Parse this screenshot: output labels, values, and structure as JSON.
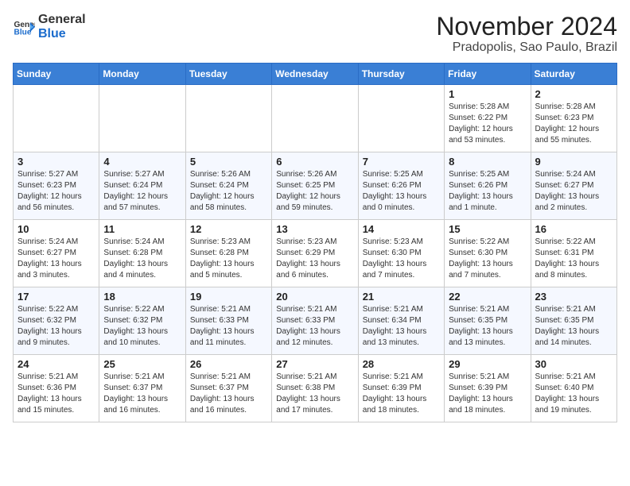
{
  "logo": {
    "general": "General",
    "blue": "Blue"
  },
  "title": "November 2024",
  "location": "Pradopolis, Sao Paulo, Brazil",
  "headers": [
    "Sunday",
    "Monday",
    "Tuesday",
    "Wednesday",
    "Thursday",
    "Friday",
    "Saturday"
  ],
  "weeks": [
    [
      {
        "day": "",
        "info": ""
      },
      {
        "day": "",
        "info": ""
      },
      {
        "day": "",
        "info": ""
      },
      {
        "day": "",
        "info": ""
      },
      {
        "day": "",
        "info": ""
      },
      {
        "day": "1",
        "info": "Sunrise: 5:28 AM\nSunset: 6:22 PM\nDaylight: 12 hours and 53 minutes."
      },
      {
        "day": "2",
        "info": "Sunrise: 5:28 AM\nSunset: 6:23 PM\nDaylight: 12 hours and 55 minutes."
      }
    ],
    [
      {
        "day": "3",
        "info": "Sunrise: 5:27 AM\nSunset: 6:23 PM\nDaylight: 12 hours and 56 minutes."
      },
      {
        "day": "4",
        "info": "Sunrise: 5:27 AM\nSunset: 6:24 PM\nDaylight: 12 hours and 57 minutes."
      },
      {
        "day": "5",
        "info": "Sunrise: 5:26 AM\nSunset: 6:24 PM\nDaylight: 12 hours and 58 minutes."
      },
      {
        "day": "6",
        "info": "Sunrise: 5:26 AM\nSunset: 6:25 PM\nDaylight: 12 hours and 59 minutes."
      },
      {
        "day": "7",
        "info": "Sunrise: 5:25 AM\nSunset: 6:26 PM\nDaylight: 13 hours and 0 minutes."
      },
      {
        "day": "8",
        "info": "Sunrise: 5:25 AM\nSunset: 6:26 PM\nDaylight: 13 hours and 1 minute."
      },
      {
        "day": "9",
        "info": "Sunrise: 5:24 AM\nSunset: 6:27 PM\nDaylight: 13 hours and 2 minutes."
      }
    ],
    [
      {
        "day": "10",
        "info": "Sunrise: 5:24 AM\nSunset: 6:27 PM\nDaylight: 13 hours and 3 minutes."
      },
      {
        "day": "11",
        "info": "Sunrise: 5:24 AM\nSunset: 6:28 PM\nDaylight: 13 hours and 4 minutes."
      },
      {
        "day": "12",
        "info": "Sunrise: 5:23 AM\nSunset: 6:28 PM\nDaylight: 13 hours and 5 minutes."
      },
      {
        "day": "13",
        "info": "Sunrise: 5:23 AM\nSunset: 6:29 PM\nDaylight: 13 hours and 6 minutes."
      },
      {
        "day": "14",
        "info": "Sunrise: 5:23 AM\nSunset: 6:30 PM\nDaylight: 13 hours and 7 minutes."
      },
      {
        "day": "15",
        "info": "Sunrise: 5:22 AM\nSunset: 6:30 PM\nDaylight: 13 hours and 7 minutes."
      },
      {
        "day": "16",
        "info": "Sunrise: 5:22 AM\nSunset: 6:31 PM\nDaylight: 13 hours and 8 minutes."
      }
    ],
    [
      {
        "day": "17",
        "info": "Sunrise: 5:22 AM\nSunset: 6:32 PM\nDaylight: 13 hours and 9 minutes."
      },
      {
        "day": "18",
        "info": "Sunrise: 5:22 AM\nSunset: 6:32 PM\nDaylight: 13 hours and 10 minutes."
      },
      {
        "day": "19",
        "info": "Sunrise: 5:21 AM\nSunset: 6:33 PM\nDaylight: 13 hours and 11 minutes."
      },
      {
        "day": "20",
        "info": "Sunrise: 5:21 AM\nSunset: 6:33 PM\nDaylight: 13 hours and 12 minutes."
      },
      {
        "day": "21",
        "info": "Sunrise: 5:21 AM\nSunset: 6:34 PM\nDaylight: 13 hours and 13 minutes."
      },
      {
        "day": "22",
        "info": "Sunrise: 5:21 AM\nSunset: 6:35 PM\nDaylight: 13 hours and 13 minutes."
      },
      {
        "day": "23",
        "info": "Sunrise: 5:21 AM\nSunset: 6:35 PM\nDaylight: 13 hours and 14 minutes."
      }
    ],
    [
      {
        "day": "24",
        "info": "Sunrise: 5:21 AM\nSunset: 6:36 PM\nDaylight: 13 hours and 15 minutes."
      },
      {
        "day": "25",
        "info": "Sunrise: 5:21 AM\nSunset: 6:37 PM\nDaylight: 13 hours and 16 minutes."
      },
      {
        "day": "26",
        "info": "Sunrise: 5:21 AM\nSunset: 6:37 PM\nDaylight: 13 hours and 16 minutes."
      },
      {
        "day": "27",
        "info": "Sunrise: 5:21 AM\nSunset: 6:38 PM\nDaylight: 13 hours and 17 minutes."
      },
      {
        "day": "28",
        "info": "Sunrise: 5:21 AM\nSunset: 6:39 PM\nDaylight: 13 hours and 18 minutes."
      },
      {
        "day": "29",
        "info": "Sunrise: 5:21 AM\nSunset: 6:39 PM\nDaylight: 13 hours and 18 minutes."
      },
      {
        "day": "30",
        "info": "Sunrise: 5:21 AM\nSunset: 6:40 PM\nDaylight: 13 hours and 19 minutes."
      }
    ]
  ]
}
